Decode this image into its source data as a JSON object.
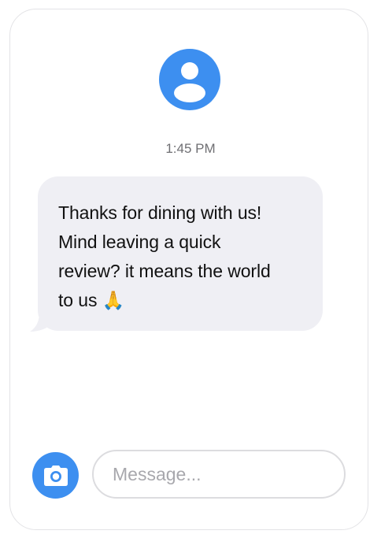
{
  "conversation": {
    "timestamp": "1:45 PM",
    "messages": [
      {
        "direction": "incoming",
        "text": "Thanks for dining with us!\nMind leaving a quick\nreview? it means the world\nto us",
        "emoji": "🙏"
      }
    ]
  },
  "composer": {
    "placeholder": "Message...",
    "value": ""
  },
  "icons": {
    "avatar": "person-icon",
    "camera": "camera-icon",
    "emoji": "folded-hands"
  },
  "colors": {
    "accent": "#3d8ff0",
    "bubble_incoming": "#efeff4",
    "timestamp_text": "#6f6f73",
    "placeholder_text": "#a8a8ad",
    "input_border": "#dcdcdf"
  }
}
